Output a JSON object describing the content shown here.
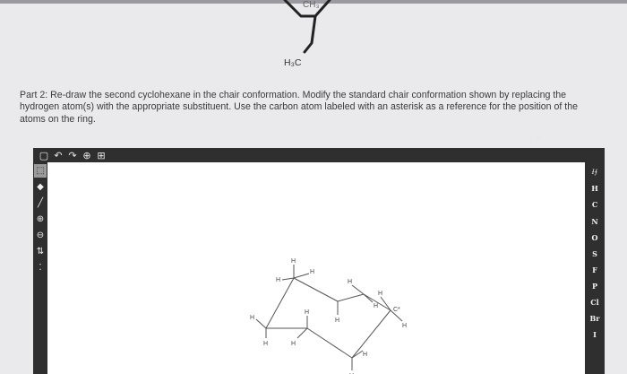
{
  "top_structure": {
    "methyl_label": "H₃C",
    "ch3_label": "CH₃"
  },
  "instructions": "Part 2: Re-draw the second cyclohexane in the chair conformation. Modify the standard chair conformation shown by replacing the hydrogen atom(s) with the appropriate substituent. Use the carbon atom labeled with an asterisk as a reference for the position of the atoms on the ring.",
  "editor": {
    "top_toolbar": [
      {
        "name": "new-document-button",
        "glyph": "▢"
      },
      {
        "name": "undo-button",
        "glyph": "↶"
      },
      {
        "name": "redo-button",
        "glyph": "↷"
      },
      {
        "name": "zoom-button",
        "glyph": "⊕"
      },
      {
        "name": "clean-button",
        "glyph": "⊞"
      }
    ],
    "left_tools": [
      {
        "name": "select-tool",
        "glyph": "⬚",
        "selected": true
      },
      {
        "name": "erase-tool",
        "glyph": "◆",
        "selected": false
      },
      {
        "name": "bond-tool",
        "glyph": "╱",
        "selected": false
      },
      {
        "name": "positive-charge-tool",
        "glyph": "⊕",
        "selected": false
      },
      {
        "name": "negative-charge-tool",
        "glyph": "⊖",
        "selected": false
      },
      {
        "name": "arrow-tool",
        "glyph": "⇅",
        "selected": false
      },
      {
        "name": "lone-pair-tool",
        "glyph": "⁚",
        "selected": false
      }
    ],
    "periodic_header": "Ɨ⨍",
    "elements": [
      "H",
      "C",
      "N",
      "O",
      "S",
      "F",
      "P",
      "Cl",
      "Br",
      "I"
    ],
    "chair": {
      "atom_labels": {
        "h": "H",
        "star_label": "C*"
      }
    }
  }
}
